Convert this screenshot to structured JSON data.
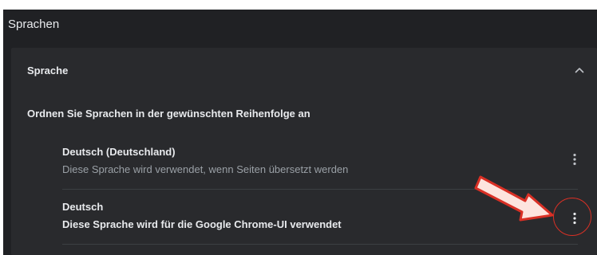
{
  "section": {
    "title": "Sprachen"
  },
  "card": {
    "title": "Sprache",
    "instruction": "Ordnen Sie Sprachen in der gewünschten Reihenfolge an"
  },
  "languages": [
    {
      "name": "Deutsch (Deutschland)",
      "description": "Diese Sprache wird verwendet, wenn Seiten übersetzt werden"
    },
    {
      "name": "Deutsch",
      "description": "Diese Sprache wird für die Google Chrome-UI verwendet"
    }
  ],
  "icons": {
    "collapse": "chevron-up-icon",
    "row_menu": "more-vert-icon"
  },
  "colors": {
    "background": "#202124",
    "card": "#292a2d",
    "text_primary": "#e8eaed",
    "text_secondary": "#9aa0a6",
    "divider": "#3c4043",
    "annotation_red": "#d93025",
    "annotation_fill": "#fde4de"
  }
}
